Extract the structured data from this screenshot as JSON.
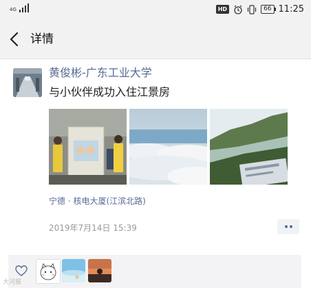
{
  "status_bar": {
    "network": "4G",
    "time": "11:25",
    "hd_label": "HD",
    "battery": "66",
    "icons": [
      "signal-icon",
      "alarm-icon",
      "vibrate-icon",
      "battery-icon"
    ]
  },
  "header": {
    "back_icon": "back-arrow-icon",
    "title": "详情"
  },
  "post": {
    "author": "黄俊彬-广东工业大学",
    "text": "与小伙伴成功入住江景房",
    "photos": [
      "group-photo",
      "clouds-sea-photo",
      "river-view-photo"
    ],
    "location": "宁德 · 核电大厦(江滨北路)",
    "timestamp": "2019年7月14日 15:39",
    "more_icon": "more-dots-icon"
  },
  "likes": {
    "heart_icon": "heart-icon",
    "likers": [
      "liker-avatar-1",
      "liker-avatar-2",
      "liker-avatar-3"
    ]
  },
  "watermark": "大河报"
}
